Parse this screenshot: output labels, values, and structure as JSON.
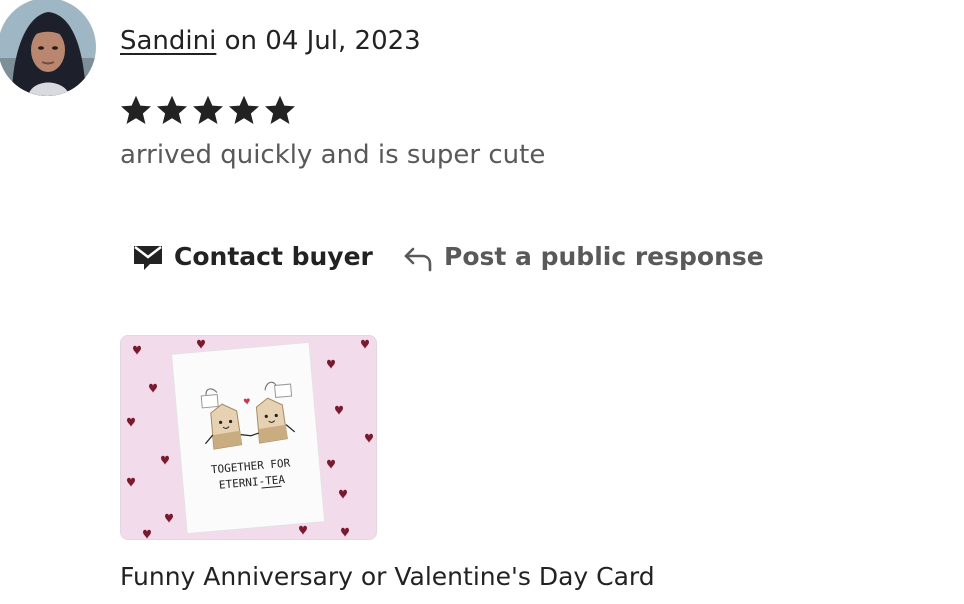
{
  "review": {
    "author": "Sandini",
    "date_prefix": " on ",
    "date": "04 Jul, 2023",
    "rating": 5,
    "rating_max": 5,
    "text": "arrived quickly and is super cute"
  },
  "actions": {
    "contact_label": "Contact buyer",
    "public_response_label": "Post a public response"
  },
  "listing": {
    "card_text_line1": "TOGETHER FOR",
    "card_text_line2": "ETERNI-TEA",
    "title": "Funny Anniversary or Valentine's Day Card"
  },
  "colors": {
    "text_primary": "#222222",
    "text_secondary": "#595959",
    "image_background": "#f2dcec",
    "heart": "#7a1a2e"
  },
  "icons": {
    "contact": "envelope-icon",
    "public_response": "reply-arrow-icon",
    "star": "star-icon"
  }
}
